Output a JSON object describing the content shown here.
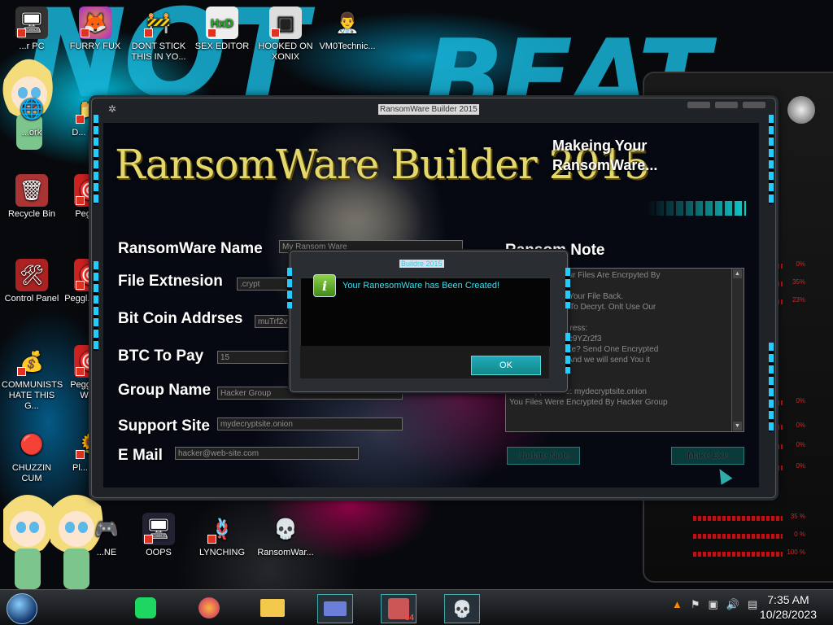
{
  "desktop": {
    "icons": [
      {
        "label": "...r PC",
        "glyph": "🖥"
      },
      {
        "label": "FURRY FUX",
        "glyph": "🦊"
      },
      {
        "label": "DONT STICK THIS IN YO...",
        "glyph": "🚧"
      },
      {
        "label": "SEX EDITOR",
        "glyph": "HxD"
      },
      {
        "label": "HOOKED ON XONIX",
        "glyph": "▣"
      },
      {
        "label": "VM0Technic...",
        "glyph": "👨‍⚕️"
      },
      {
        "label": "...ork",
        "glyph": "🌐"
      },
      {
        "label": "D... DU...",
        "glyph": "📁"
      },
      {
        "label": "Recycle Bin",
        "glyph": "🗑"
      },
      {
        "label": "Peggl...",
        "glyph": "🎯"
      },
      {
        "label": "Control Panel",
        "glyph": "🛠"
      },
      {
        "label": "Peggl... De...",
        "glyph": "🎯"
      },
      {
        "label": "COMMUNISTS HATE THIS G...",
        "glyph": "💰"
      },
      {
        "label": "Peggl... of Wa...",
        "glyph": "🎯"
      },
      {
        "label": "CHUZZIN CUM",
        "glyph": "🔴"
      },
      {
        "label": "Pl... Zo...",
        "glyph": "🌻"
      },
      {
        "label": "...NE",
        "glyph": "🎮"
      },
      {
        "label": "OOPS",
        "glyph": "🖥"
      },
      {
        "label": "LYNCHING",
        "glyph": "🪢"
      },
      {
        "label": "RansomWar...",
        "glyph": "💀"
      }
    ]
  },
  "main_window": {
    "title": "RansomWare Builder 2015",
    "banner": "RansomWare Builder 2015",
    "status_text": "Makeing Your RansomWare...",
    "fields": {
      "name": {
        "label": "RansomWare Name",
        "value": "My Ransom Ware"
      },
      "extension": {
        "label": "File Extnesion",
        "value": ".crypt"
      },
      "btc_address": {
        "label": "Bit Coin Addrses",
        "value": "muTrf2v"
      },
      "btc_amount": {
        "label": "BTC To Pay",
        "value": "15"
      },
      "group": {
        "label": "Group Name",
        "value": "Hacker Group"
      },
      "support": {
        "label": "Support Site",
        "value": "mydecryptsite.onion"
      },
      "email": {
        "label": "E Mail",
        "value": "hacker@web-site.com"
      }
    },
    "note": {
      "label": "Ransom Note",
      "lines": [
        "So Sorry. But Your Files Are Encrpyted By",
        "are",
        "ry! You Can Get Your File Back.",
        "Use Other Tools To Decryt. Onlt Use Our",
        "",
        "Our Bit Coin Address:",
        "ropS9TY4fEoU4c9YZr2f3",
        "ous We Aere Fake? Send One Encrypted",
        "@web-site.com And we will send You it",
        "",
        "",
        "Our Support Site: mydecryptsite.onion",
        "You Files Were Encrypted By Hacker Group"
      ]
    },
    "buttons": {
      "update": "Update Note",
      "make": "Make Exe"
    }
  },
  "dialog": {
    "title": "Buildre 2015",
    "message": "Your RanesomWare has Been Created!",
    "ok": "OK"
  },
  "widget": {
    "rows": [
      "0%",
      "35%",
      "23%",
      "0%",
      "0%",
      "0%",
      "0%"
    ],
    "bottom_rows": [
      "35 %",
      "0 %",
      "100 %"
    ]
  },
  "taskbar": {
    "apps": [
      "spotify-icon",
      "firefox-icon",
      "explorer-icon",
      "id-card-icon",
      "avatar-icon",
      "skull-icon"
    ],
    "badge": "64",
    "time": "7:35 AM",
    "date": "10/28/2023"
  }
}
